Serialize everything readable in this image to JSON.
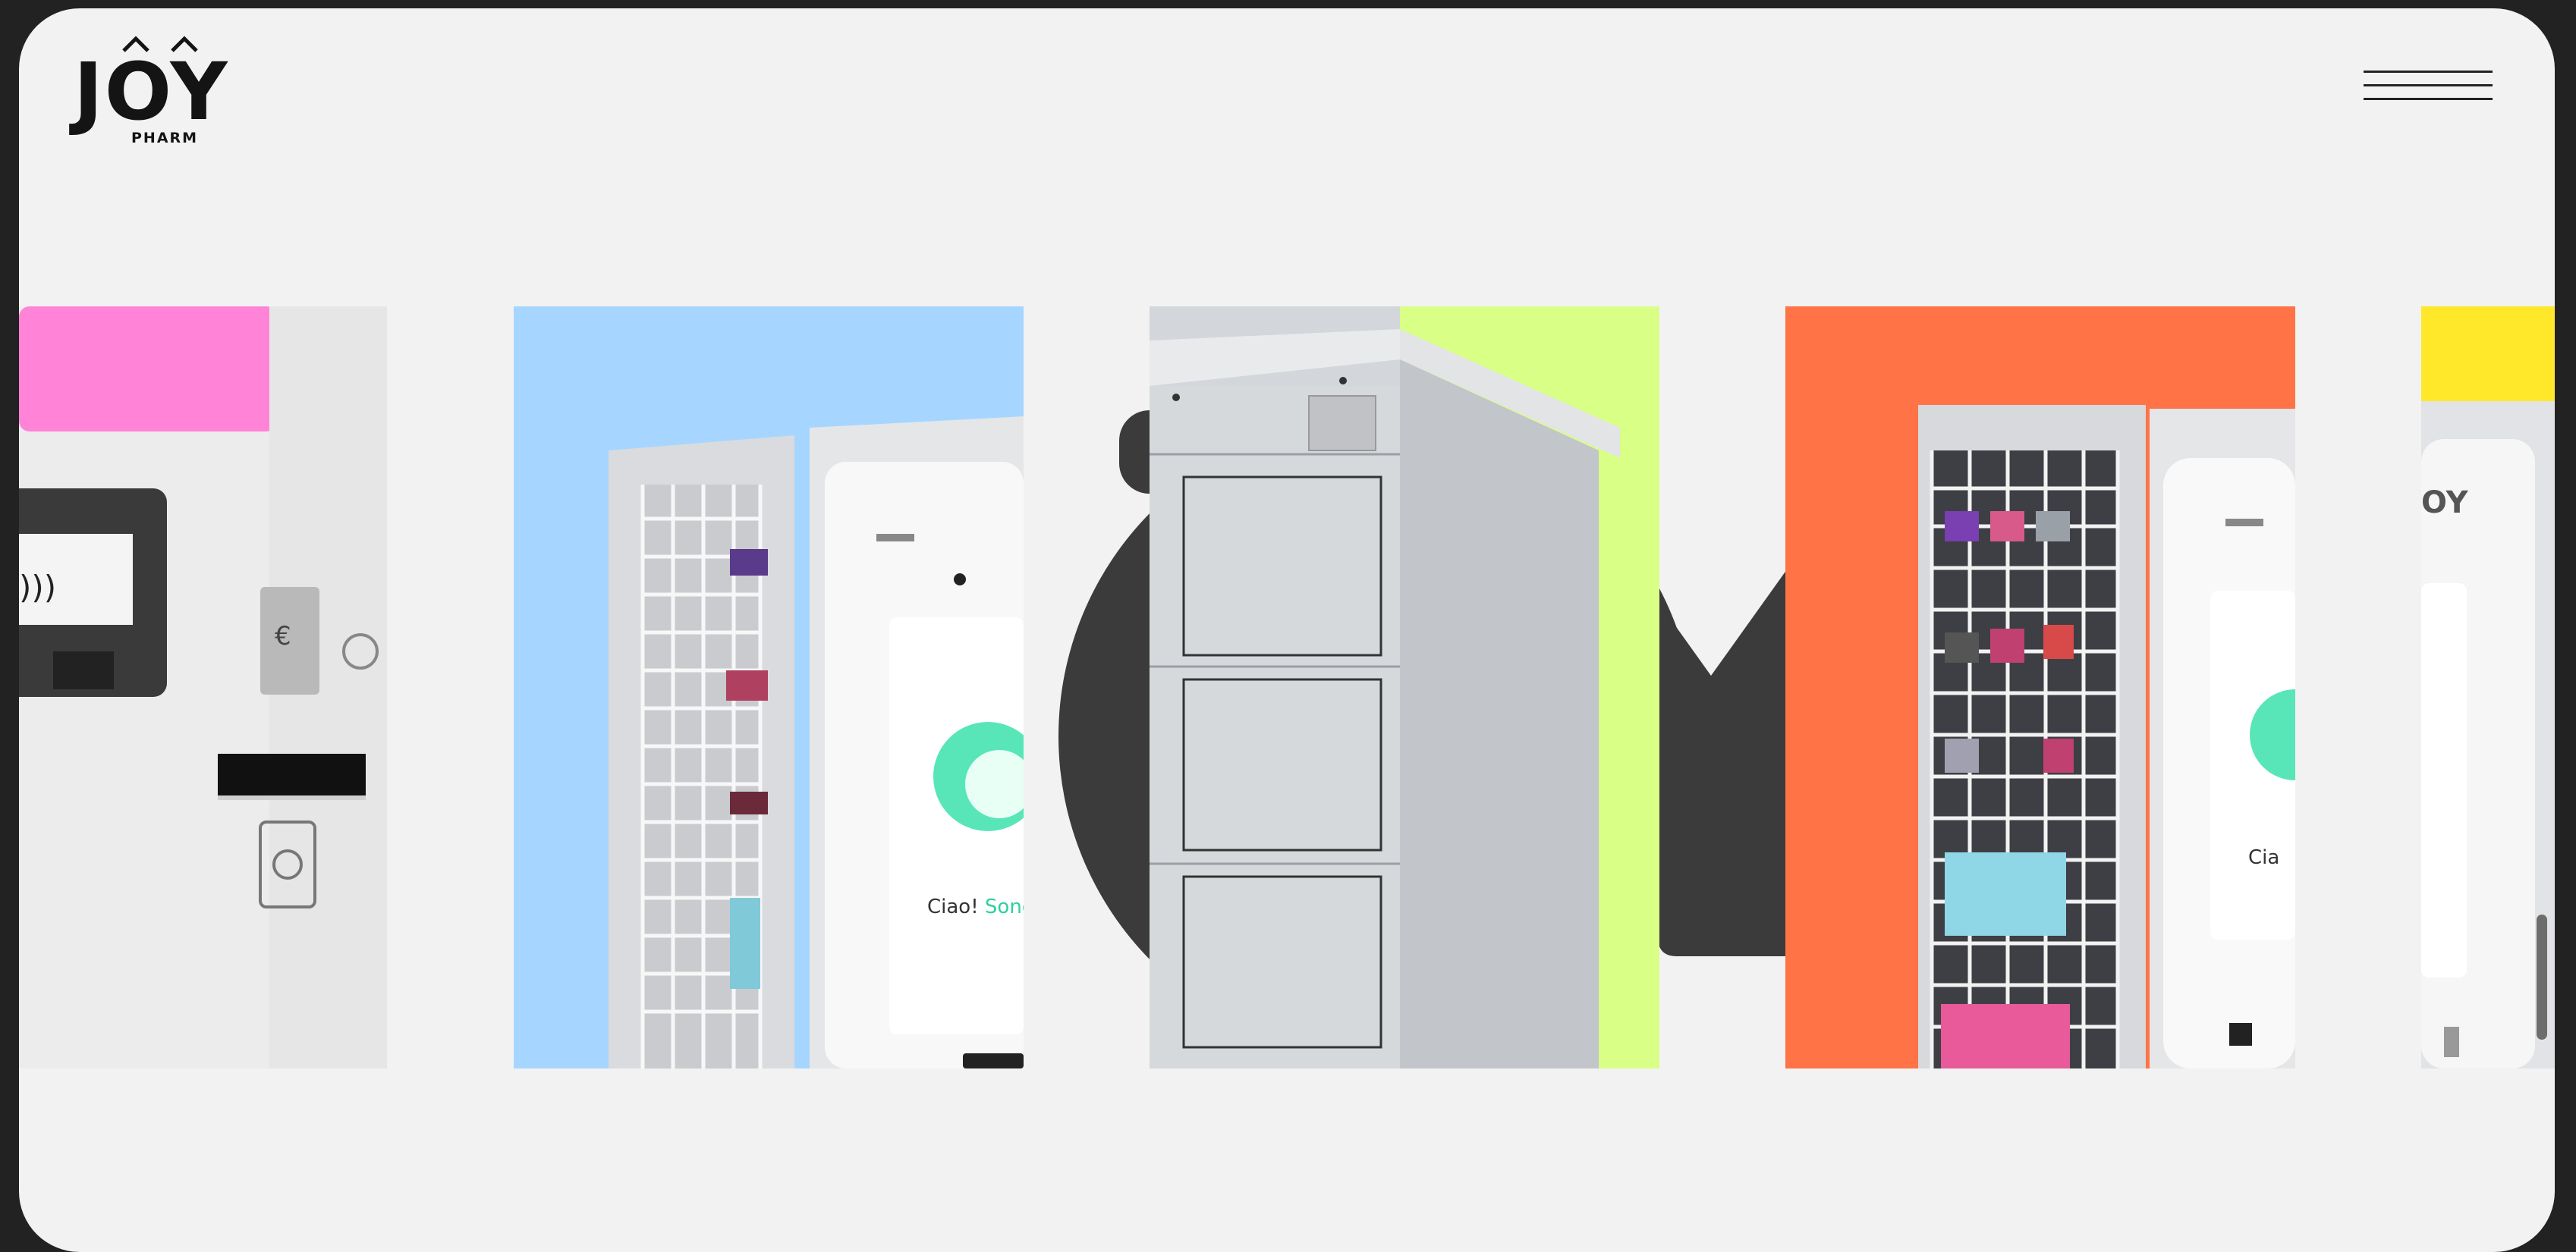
{
  "brand": {
    "name": "JOY",
    "tagline": "PHARM"
  },
  "menu": {
    "icon": "hamburger-menu-icon"
  },
  "colors": {
    "page_bg": "#f2f2f2",
    "frame_bg": "#222222",
    "letter_fill": "#3b3b3b",
    "panel_pink": "#ff84d8",
    "panel_blue": "#a6d6ff",
    "panel_lime": "#d9ff86",
    "panel_orange": "#ff7346",
    "panel_yellow": "#ffe82a"
  },
  "panels": [
    {
      "id": "pink",
      "subject": "vending-machine-payment-detail"
    },
    {
      "id": "blue",
      "subject": "vending-machine-front",
      "screen_text_prefix": "Ciao!",
      "screen_text_accent": "Sono J"
    },
    {
      "id": "lime",
      "subject": "locker-side-view"
    },
    {
      "id": "orange",
      "subject": "vending-machine-full",
      "screen_text": "Cia"
    },
    {
      "id": "yellow",
      "subject": "vending-machine-edge",
      "screen_text": "OY"
    }
  ]
}
